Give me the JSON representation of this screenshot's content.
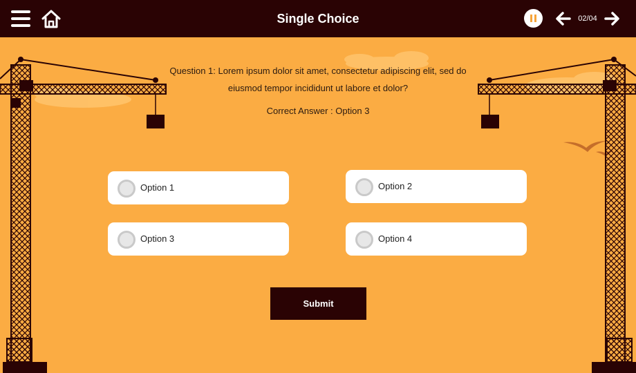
{
  "header": {
    "title": "Single Choice",
    "menu_icon": "hamburger-menu-icon",
    "home_icon": "home-icon",
    "pause_icon": "pause-icon",
    "prev_icon": "arrow-left-icon",
    "next_icon": "arrow-right-icon",
    "page_counter": "02/04"
  },
  "quiz": {
    "question": "Question 1: Lorem ipsum dolor sit amet, consectetur adipiscing elit, sed do eiusmod tempor incididunt ut labore et dolor?",
    "correct_answer": "Correct Answer : Option 3",
    "options": [
      {
        "label": "Option 1",
        "selected": false
      },
      {
        "label": "Option 2",
        "selected": false
      },
      {
        "label": "Option 3",
        "selected": false
      },
      {
        "label": "Option 4",
        "selected": false
      }
    ],
    "submit_label": "Submit"
  },
  "theme": {
    "header_bg": "#2A0304",
    "background": "#FBAC43",
    "accent": "#F6A43A",
    "crane_color": "#2A0304"
  }
}
